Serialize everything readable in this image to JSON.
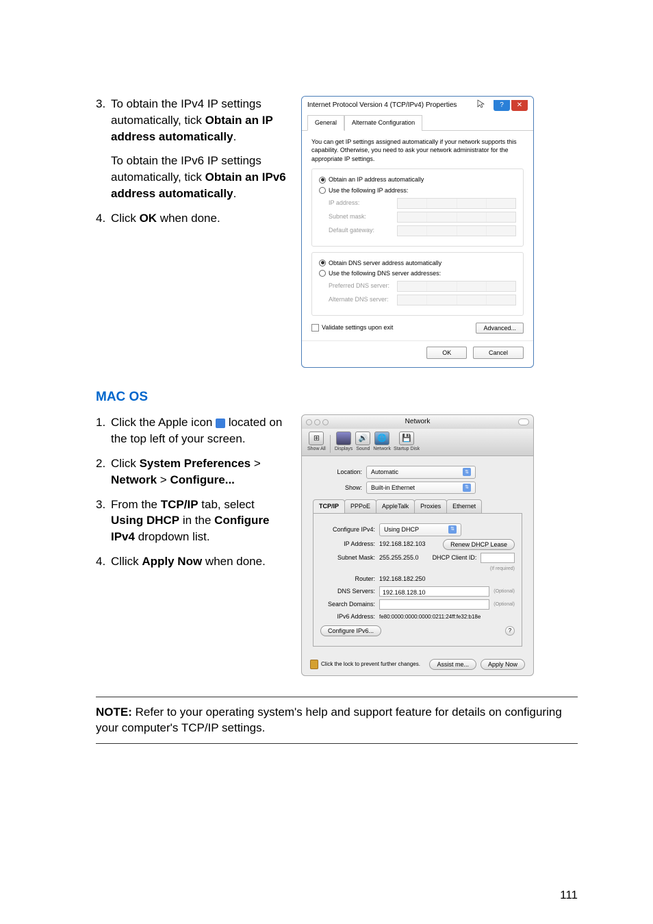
{
  "page_number": "111",
  "step3": {
    "num": "3.",
    "text_a": "To obtain the IPv4 IP settings automatically, tick ",
    "text_b": "Obtain an IP address automatically",
    "text_c": "."
  },
  "step3_sub": {
    "text_a": "To obtain the IPv6 IP settings automatically, tick ",
    "text_b": "Obtain an IPv6 address automatically",
    "text_c": "."
  },
  "step4": {
    "num": "4.",
    "text_a": "Click ",
    "text_b": "OK",
    "text_c": " when done."
  },
  "mac_heading": "MAC OS",
  "mac_step1": {
    "num": "1.",
    "text_a": "Click the Apple icon ",
    "text_b": " located on the top left of your screen."
  },
  "mac_step2": {
    "num": "2.",
    "text_a": "Click ",
    "text_b": "System Preferences",
    "text_c": " > ",
    "text_d": "Network",
    "text_e": " > ",
    "text_f": "Configure..."
  },
  "mac_step3": {
    "num": "3.",
    "text_a": "From the ",
    "text_b": "TCP/IP",
    "text_c": " tab, select ",
    "text_d": "Using DHCP",
    "text_e": " in the ",
    "text_f": "Configure IPv4",
    "text_g": " dropdown list."
  },
  "mac_step4": {
    "num": "4.",
    "text_a": "Cllick ",
    "text_b": "Apply Now",
    "text_c": " when done."
  },
  "note": {
    "label": "NOTE:",
    "text": " Refer to your operating system's help and support feature for details on configuring your computer's TCP/IP settings."
  },
  "win_dialog": {
    "title": "Internet Protocol Version 4 (TCP/IPv4) Properties",
    "tab_general": "General",
    "tab_alt": "Alternate Configuration",
    "desc": "You can get IP settings assigned automatically if your network supports this capability. Otherwise, you need to ask your network administrator for the appropriate IP settings.",
    "radio_auto_ip": "Obtain an IP address automatically",
    "radio_use_ip": "Use the following IP address:",
    "ip_address": "IP address:",
    "subnet": "Subnet mask:",
    "gateway": "Default gateway:",
    "radio_auto_dns": "Obtain DNS server address automatically",
    "radio_use_dns": "Use the following DNS server addresses:",
    "pref_dns": "Preferred DNS server:",
    "alt_dns": "Alternate DNS server:",
    "validate": "Validate settings upon exit",
    "advanced": "Advanced...",
    "ok": "OK",
    "cancel": "Cancel"
  },
  "mac_dialog": {
    "title": "Network",
    "tb_showall": "Show All",
    "tb_displays": "Displays",
    "tb_sound": "Sound",
    "tb_network": "Network",
    "tb_startup": "Startup Disk",
    "location_label": "Location:",
    "location_val": "Automatic",
    "show_label": "Show:",
    "show_val": "Built-in Ethernet",
    "tab_tcpip": "TCP/IP",
    "tab_pppoe": "PPPoE",
    "tab_appletalk": "AppleTalk",
    "tab_proxies": "Proxies",
    "tab_ethernet": "Ethernet",
    "conf_ipv4_label": "Configure IPv4:",
    "conf_ipv4_val": "Using DHCP",
    "ip_label": "IP Address:",
    "ip_val": "192.168.182.103",
    "renew": "Renew DHCP Lease",
    "subnet_label": "Subnet Mask:",
    "subnet_val": "255.255.255.0",
    "clientid_label": "DHCP Client ID:",
    "ifreq": "(If required)",
    "router_label": "Router:",
    "router_val": "192.168.182.250",
    "dns_label": "DNS Servers:",
    "dns_val": "192.168.128.10",
    "optional": "(Optional)",
    "search_label": "Search Domains:",
    "ipv6_label": "IPv6 Address:",
    "ipv6_val": "fe80:0000:0000:0000:0211:24ff:fe32:b18e",
    "conf_ipv6": "Configure IPv6...",
    "help": "?",
    "lock_text": "Click the lock to prevent further changes.",
    "assist": "Assist me...",
    "apply": "Apply Now"
  }
}
